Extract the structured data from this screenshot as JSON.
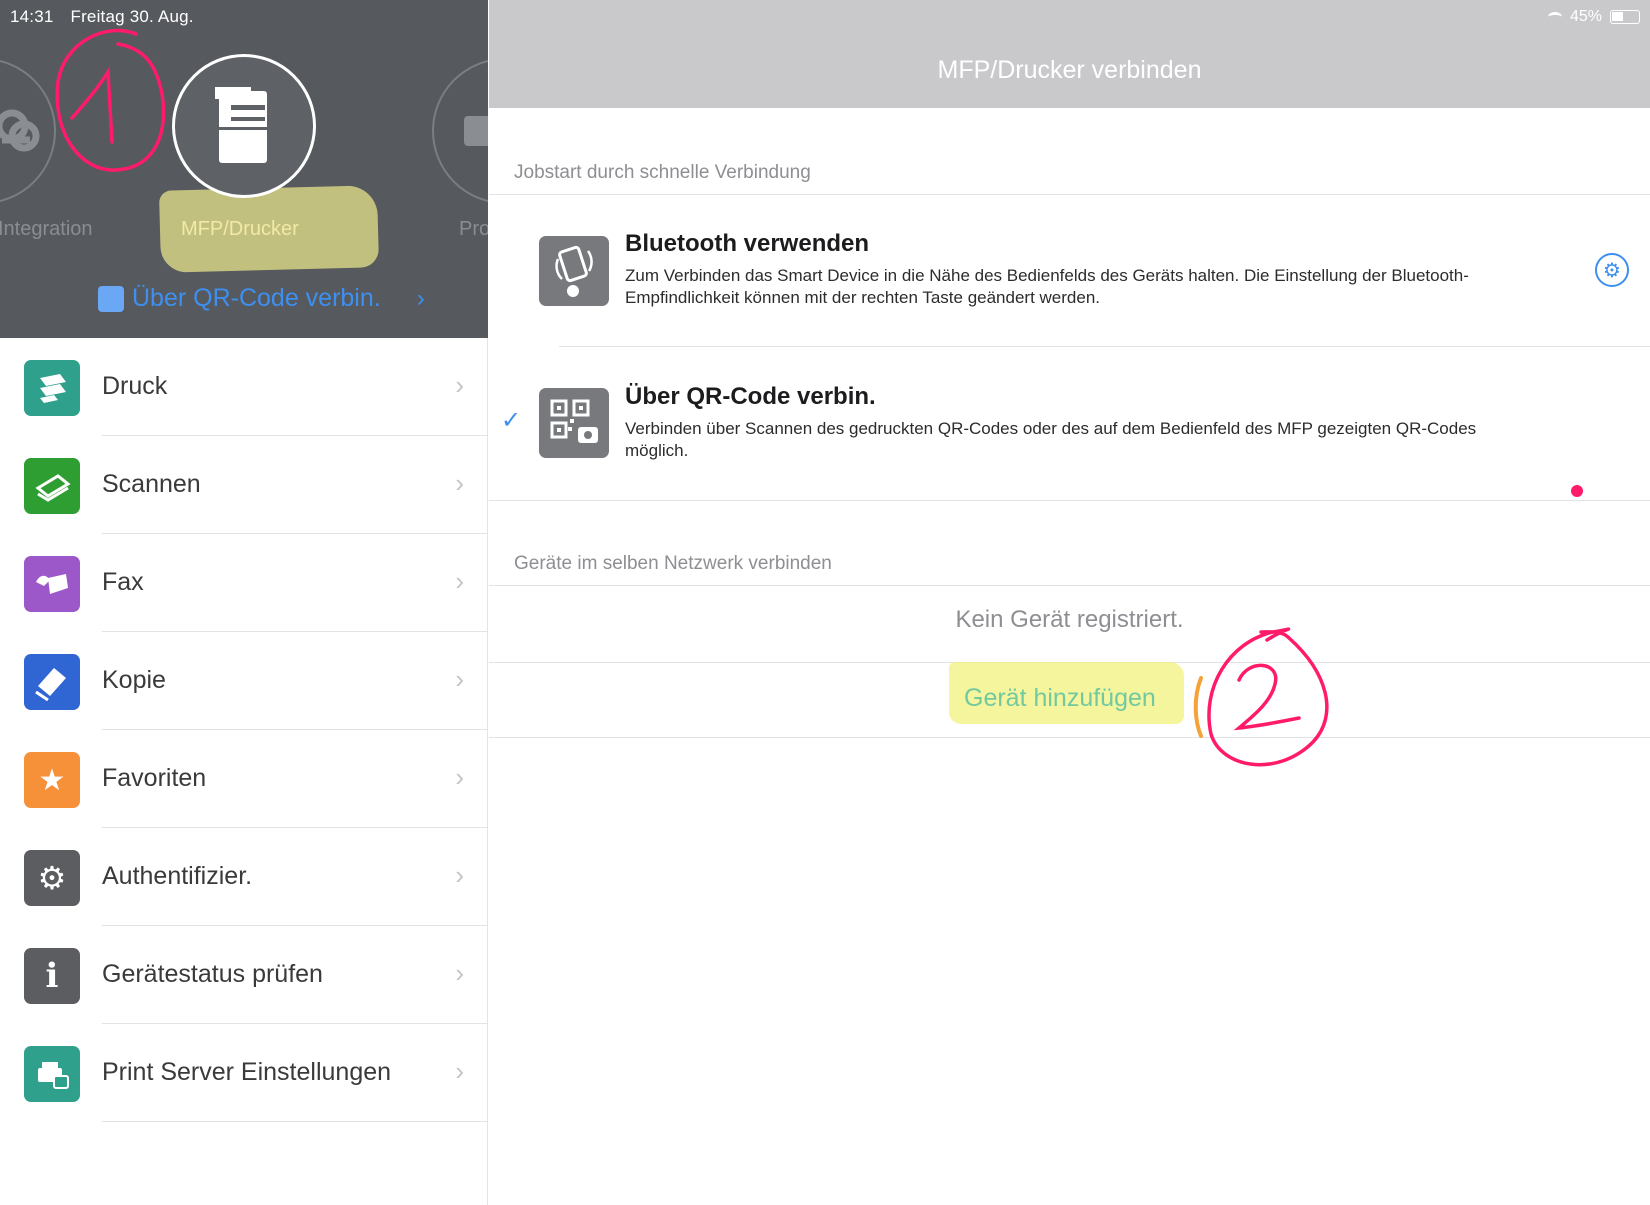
{
  "status_bar": {
    "time": "14:31",
    "date": "Freitag 30. Aug.",
    "battery": "45%"
  },
  "carousel": {
    "left_label": "Integration",
    "center_label": "MFP/Drucker",
    "right_label": "Pro",
    "qr_link_label": "Über QR-Code verbin."
  },
  "menu": {
    "items": [
      {
        "label": "Druck",
        "icon": "print-icon",
        "color": "#2fa08c"
      },
      {
        "label": "Scannen",
        "icon": "scan-icon",
        "color": "#2e9e32"
      },
      {
        "label": "Fax",
        "icon": "fax-icon",
        "color": "#9c57c8"
      },
      {
        "label": "Kopie",
        "icon": "copy-icon",
        "color": "#2f66d4"
      },
      {
        "label": "Favoriten",
        "icon": "star-icon",
        "color": "#f6913a"
      },
      {
        "label": "Authentifizier.",
        "icon": "gear-icon",
        "color": "#5b5d61"
      },
      {
        "label": "Gerätestatus prüfen",
        "icon": "info-icon",
        "color": "#5b5d61"
      },
      {
        "label": "Print Server Einstellungen",
        "icon": "print-server-icon",
        "color": "#2fa08c"
      }
    ]
  },
  "main": {
    "title": "MFP/Drucker verbinden",
    "section_quick": "Jobstart durch schnelle Verbindung",
    "bluetooth": {
      "title": "Bluetooth verwenden",
      "description": "Zum Verbinden das Smart Device in die Nähe des Bedienfelds des Geräts halten. Die Einstellung der Bluetooth-Empfindlichkeit können mit der rechten Taste geändert werden."
    },
    "qr": {
      "title": "Über QR-Code verbin.",
      "description": "Verbinden über Scannen des gedruckten QR-Codes oder des auf dem Bedienfeld des MFP gezeigten QR-Codes möglich."
    },
    "section_network": "Geräte im selben Netzwerk verbinden",
    "no_device": "Kein Gerät registriert.",
    "add_device": "Gerät hinzufügen"
  },
  "colors": {
    "accent": "#3d8ff0",
    "annotation": "#ff1b6a",
    "highlighter": "#ecec78",
    "left_header_bg": "#56595e",
    "nav_bar_bg": "#c9c9cc"
  }
}
